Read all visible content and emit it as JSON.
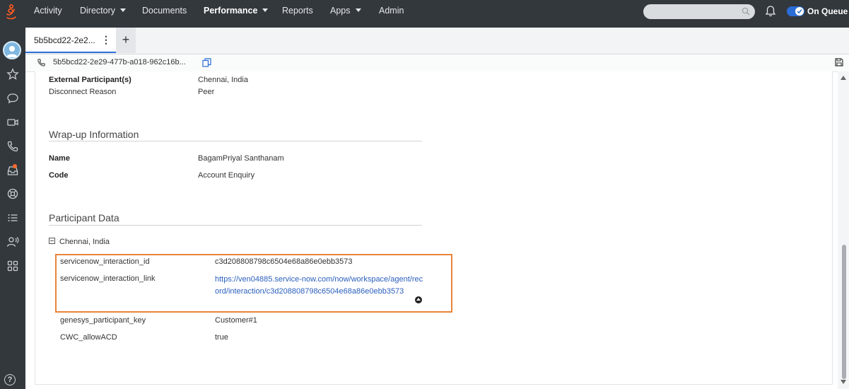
{
  "nav": {
    "items": [
      {
        "label": "Activity"
      },
      {
        "label": "Directory"
      },
      {
        "label": "Documents"
      },
      {
        "label": "Performance"
      },
      {
        "label": "Reports"
      },
      {
        "label": "Apps"
      },
      {
        "label": "Admin"
      }
    ],
    "status_label": "On Queue",
    "colors": {
      "bar": "#33383d",
      "accent": "#2a6dd6"
    }
  },
  "tabs": {
    "active_label": "5b5bcd22-2e2...",
    "add_label": "+"
  },
  "subbar": {
    "interaction_id": "5b5bcd22-2e29-477b-a018-962c16b..."
  },
  "details": {
    "external_participant_label": "External Participant(s)",
    "external_participant_value": "Chennai, India",
    "disconnect_reason_label": "Disconnect Reason",
    "disconnect_reason_value": "Peer"
  },
  "wrapup": {
    "title": "Wrap-up Information",
    "name_label": "Name",
    "name_value": "BagamPriyal Santhanam",
    "code_label": "Code",
    "code_value": "Account Enquiry"
  },
  "participant_data": {
    "title": "Participant Data",
    "group_label": "Chennai, India",
    "rows": [
      {
        "key": "servicenow_interaction_id",
        "value": "c3d208808798c6504e68a86e0ebb3573"
      },
      {
        "key": "servicenow_interaction_link",
        "value": "https://ven04885.service-now.com/now/workspace/agent/record/interaction/c3d208808798c6504e68a86e0ebb3573"
      },
      {
        "key": "genesys_participant_key",
        "value": "Customer#1"
      },
      {
        "key": "CWC_allowACD",
        "value": "true"
      }
    ],
    "highlight_color": "#e8843a"
  },
  "help_label": "?"
}
